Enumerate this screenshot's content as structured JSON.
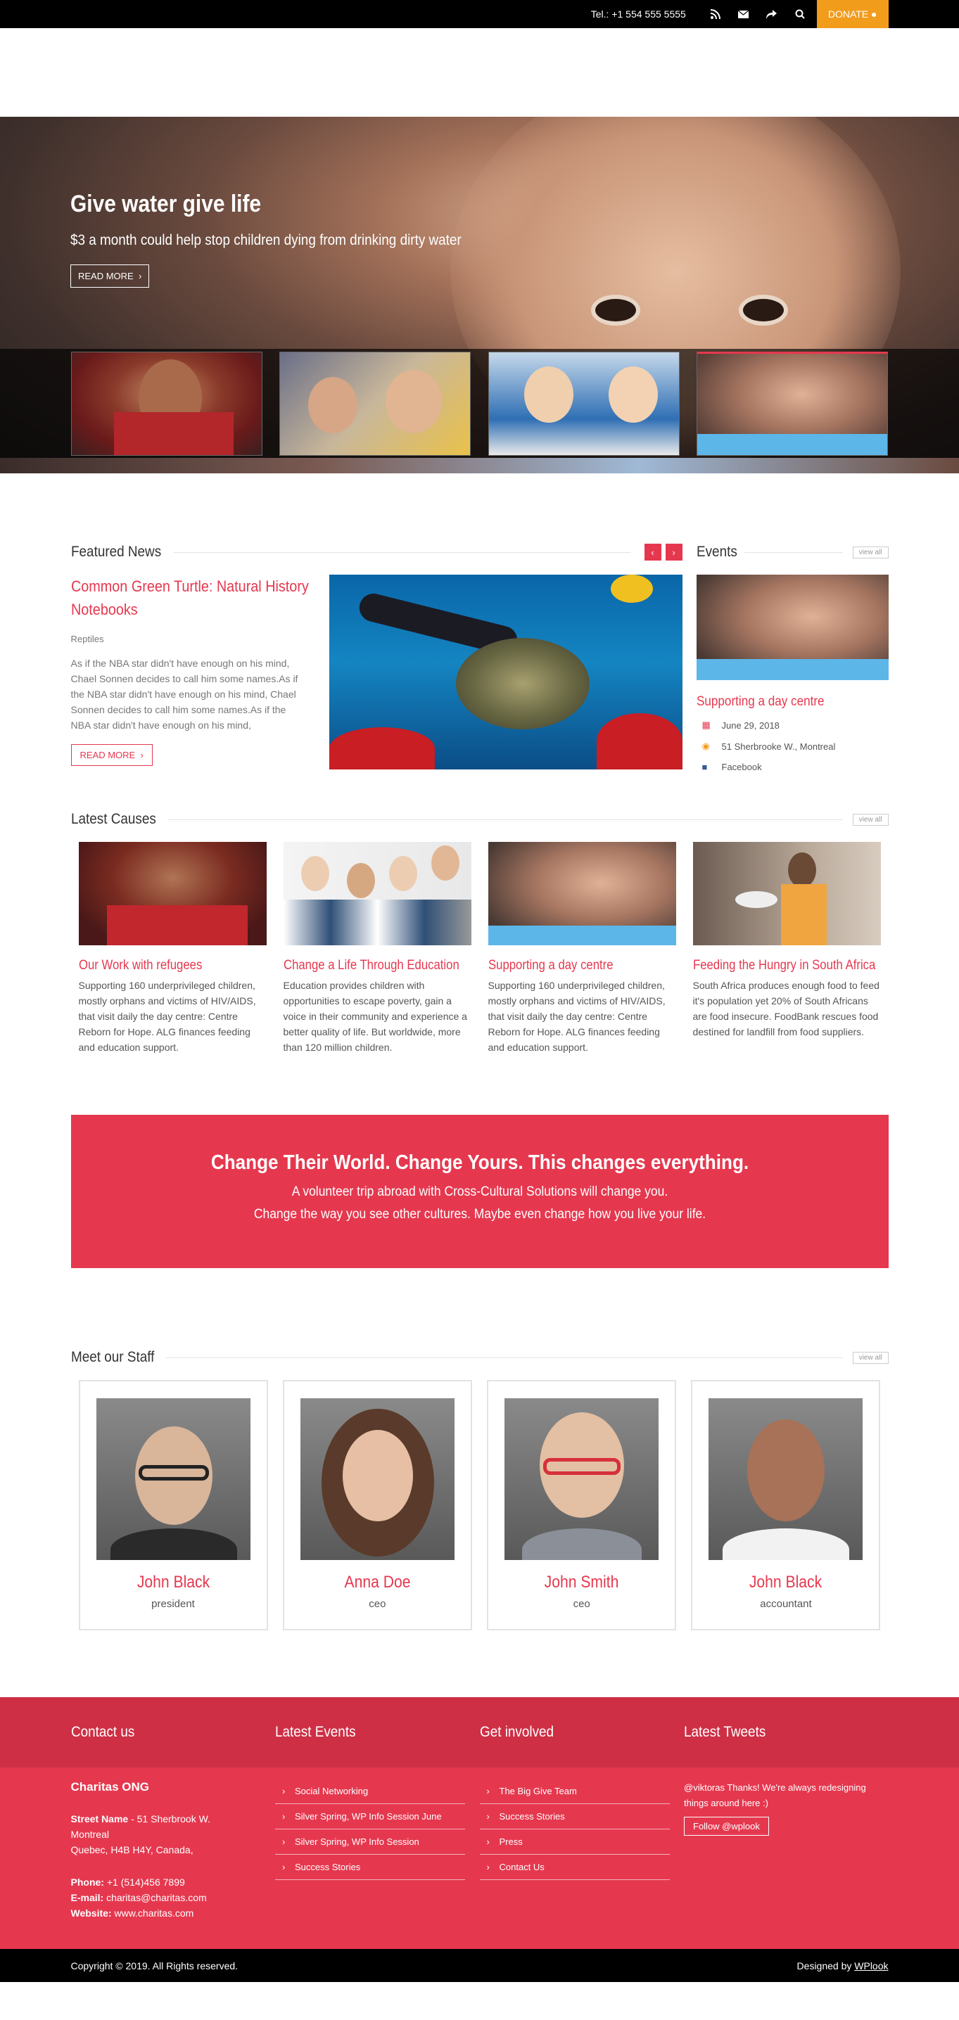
{
  "topbar": {
    "phone": "Tel.: +1 554 555 5555",
    "icons": [
      "rss-icon",
      "mail-icon",
      "share-icon",
      "search-icon"
    ],
    "donate": "DONATE"
  },
  "hero": {
    "title": "Give water give life",
    "subtitle": "$3 a month could help stop children dying from drinking dirty water",
    "button": "READ MORE"
  },
  "featured": {
    "heading": "Featured News",
    "post": {
      "title": "Common Green Turtle: Natural History Notebooks",
      "category": "Reptiles",
      "excerpt": "As if the NBA star didn't have enough on his mind, Chael Sonnen decides to call him some names.As if the NBA star didn't have enough on his mind, Chael Sonnen decides to call him some names.As if the NBA star didn't have enough on his mind,",
      "button": "READ MORE"
    }
  },
  "events": {
    "heading": "Events",
    "viewall": "view all",
    "item": {
      "title": "Supporting a day centre",
      "date": "June 29, 2018",
      "location": "51 Sherbrooke W., Montreal",
      "social": "Facebook"
    }
  },
  "causes": {
    "heading": "Latest Causes",
    "viewall": "view all",
    "items": [
      {
        "title": "Our Work with refugees",
        "text": "Supporting 160 underprivileged children, mostly orphans and victims of HIV/AIDS, that visit daily the day centre: Centre Reborn for Hope. ALG finances feeding and education support."
      },
      {
        "title": "Change a Life Through Education",
        "text": "Education provides children with opportunities to escape poverty, gain a voice in their community and experience a better quality of life. But worldwide, more than 120 million children."
      },
      {
        "title": "Supporting a day centre",
        "text": "Supporting 160 underprivileged children, mostly orphans and victims of HIV/AIDS, that visit daily the day centre: Centre Reborn for Hope. ALG finances feeding and education support."
      },
      {
        "title": "Feeding the Hungry in South Africa",
        "text": "South Africa produces enough food to feed it's population yet 20% of South Africans are food insecure. FoodBank rescues food destined for landfill from food suppliers."
      }
    ]
  },
  "cta": {
    "title": "Change Their World. Change Yours. This changes everything.",
    "line1": "A volunteer trip abroad with Cross-Cultural Solutions will change you.",
    "line2": "Change the way you see other cultures. Maybe even change how you live your life."
  },
  "staff": {
    "heading": "Meet our Staff",
    "viewall": "view all",
    "members": [
      {
        "name": "John Black",
        "role": "president"
      },
      {
        "name": "Anna Doe",
        "role": "ceo"
      },
      {
        "name": "John Smith",
        "role": "ceo"
      },
      {
        "name": "John Black",
        "role": "accountant"
      }
    ]
  },
  "footer": {
    "contact": {
      "heading": "Contact us",
      "org": "Charitas ONG",
      "street_label": "Street Name",
      "street": " - 51 Sherbrook W.",
      "city": "Montreal",
      "region": "Quebec, H4B H4Y, Canada,",
      "phone_label": "Phone:",
      "phone": " +1 (514)456 7899",
      "email_label": "E-mail:",
      "email": " charitas@charitas.com",
      "website_label": "Website:",
      "website": " www.charitas.com"
    },
    "events": {
      "heading": "Latest Events",
      "links": [
        "Social Networking",
        "Silver Spring, WP Info Session June",
        "Silver Spring, WP Info Session",
        "Success Stories"
      ]
    },
    "involved": {
      "heading": "Get involved",
      "links": [
        "The Big Give Team",
        "Success Stories",
        "Press",
        "Contact Us"
      ]
    },
    "tweets": {
      "heading": "Latest Tweets",
      "tweet": "@viktoras Thanks! We're always redesigning things around here :)",
      "follow": "Follow @wplook"
    }
  },
  "bottom": {
    "copyright": "Copyright © 2019. All Rights reserved.",
    "designed_prefix": "Designed by ",
    "designed_link": "WPlook"
  },
  "colors": {
    "accent": "#e5384f",
    "donate": "#f29c1c",
    "footer_head": "#ce2f45"
  }
}
